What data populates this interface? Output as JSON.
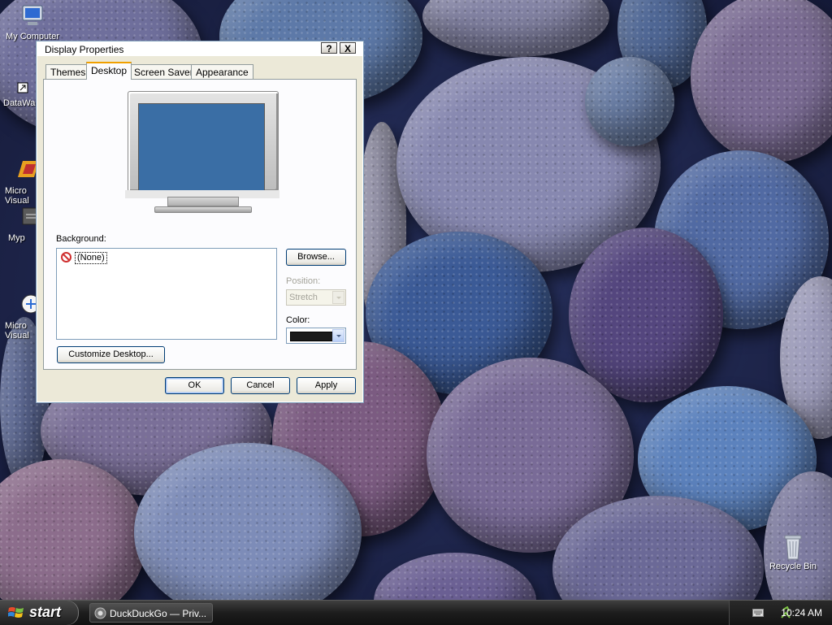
{
  "desktop": {
    "icons": [
      {
        "label": "My Computer"
      },
      {
        "label": "DataWa"
      },
      {
        "label": "Micro\nVisual"
      },
      {
        "label": "Myp"
      },
      {
        "label": "Micro\nVisual"
      },
      {
        "label": "Recycle Bin"
      }
    ]
  },
  "dialog": {
    "title": "Display Properties",
    "help_label": "?",
    "close_label": "X",
    "tabs": [
      {
        "label": "Themes"
      },
      {
        "label": "Desktop",
        "active": true
      },
      {
        "label": "Screen Saver"
      },
      {
        "label": "Appearance"
      }
    ],
    "background_label": "Background:",
    "background_items": [
      {
        "label": "(None)",
        "icon": "no-symbol-icon",
        "selected": true
      }
    ],
    "browse_label": "Browse...",
    "position_label": "Position:",
    "position_value": "Stretch",
    "color_label": "Color:",
    "color_value": "#1a1a1a",
    "customize_label": "Customize Desktop...",
    "ok_label": "OK",
    "cancel_label": "Cancel",
    "apply_label": "Apply",
    "preview_color": "#3a6ea5"
  },
  "taskbar": {
    "start_label": "start",
    "task_label": "DuckDuckGo — Priv...",
    "clock": "10:24 AM"
  },
  "colors": {
    "accent": "#f0a000",
    "selection": "#316ac5"
  }
}
